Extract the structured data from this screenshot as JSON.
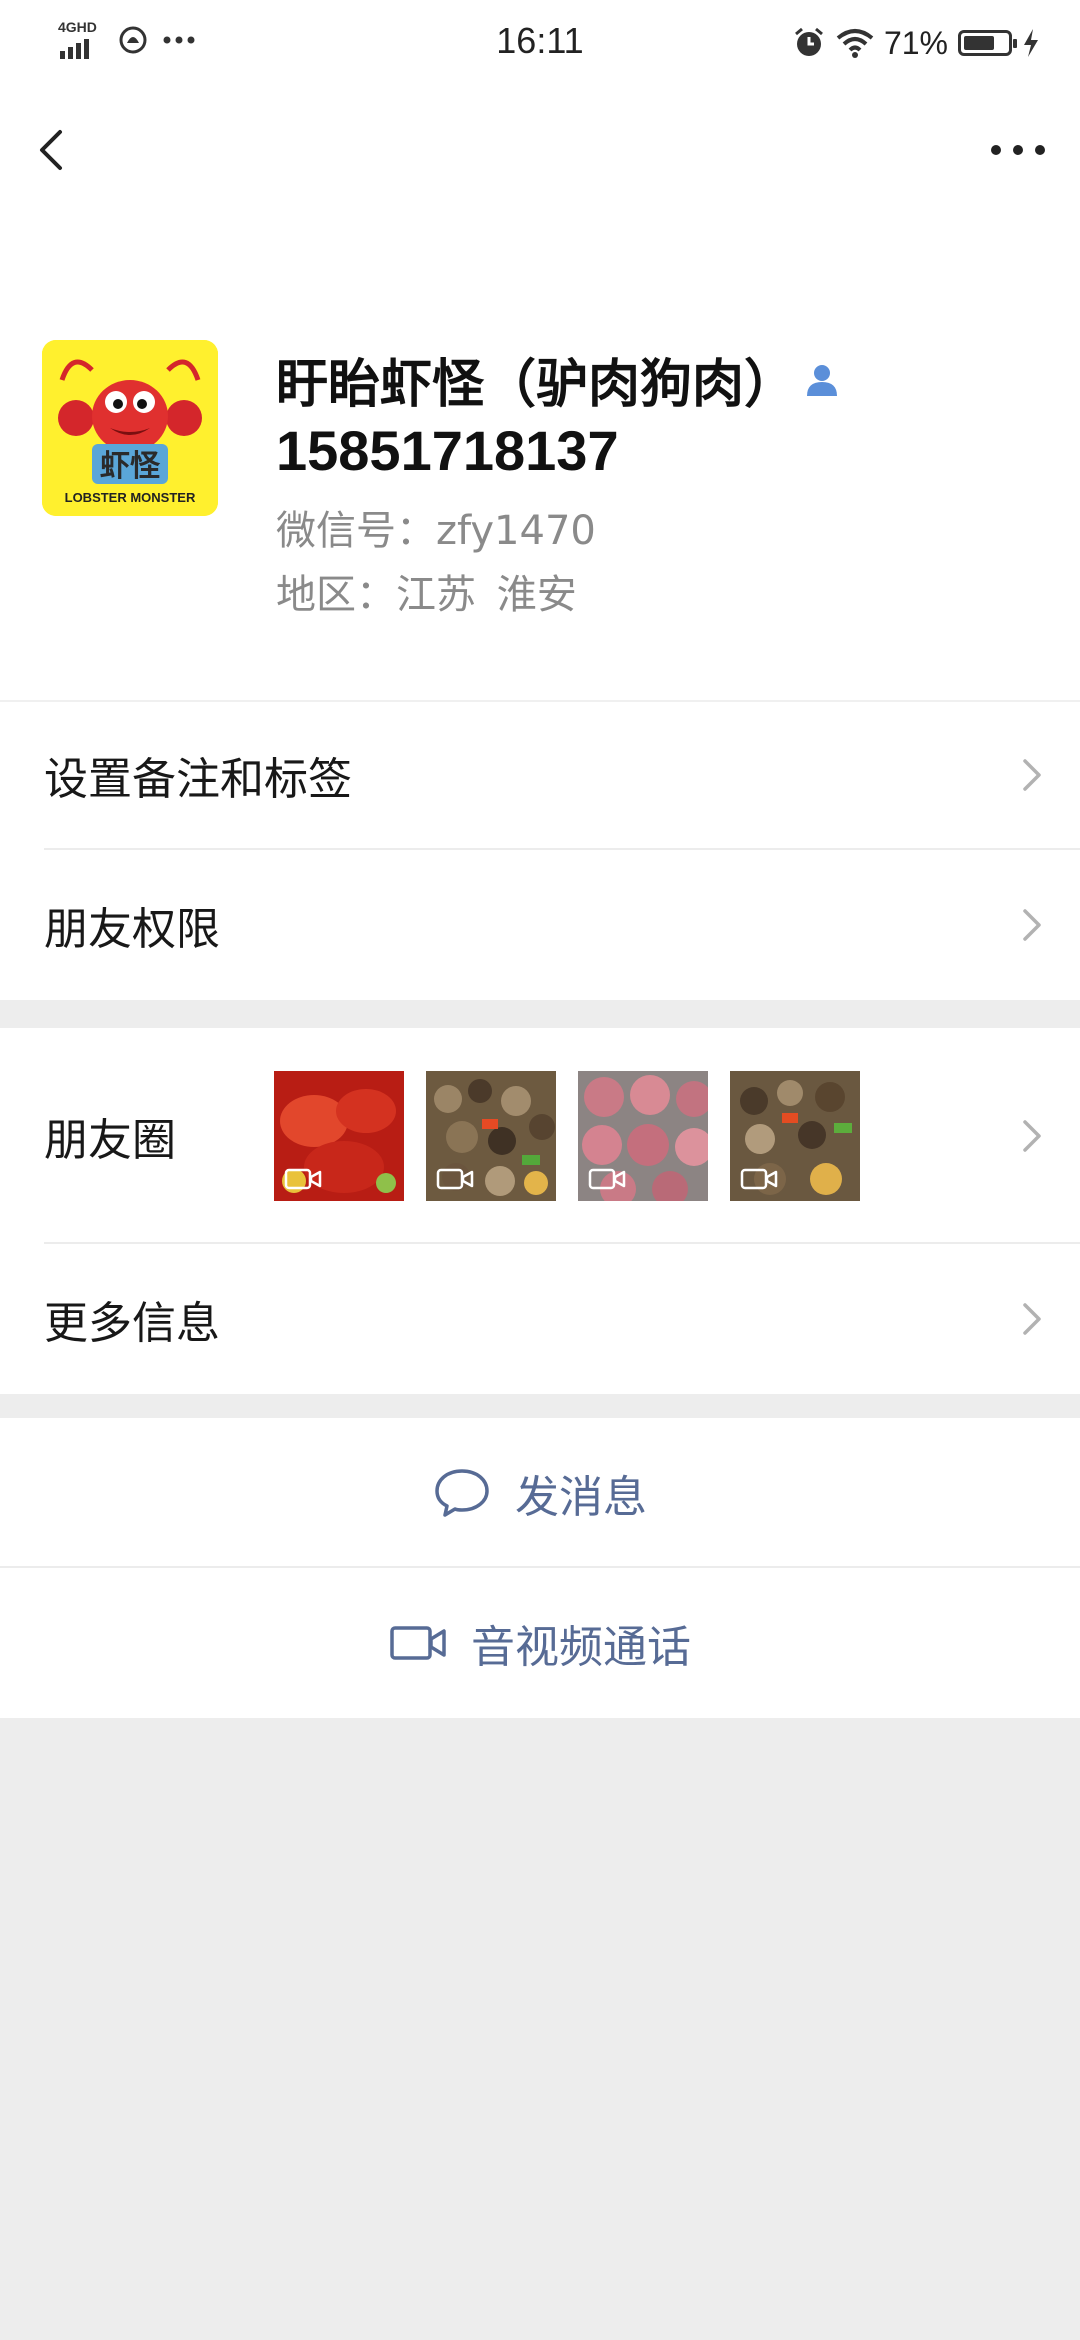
{
  "status_bar": {
    "network": "4GHD",
    "time": "16:11",
    "battery_percent": "71%",
    "battery_level": 0.71,
    "icons": [
      "signal-icon",
      "alert-icon",
      "more-dots-icon",
      "alarm-icon",
      "wifi-icon",
      "battery-icon",
      "charging-icon"
    ]
  },
  "nav": {
    "back_icon": "chevron-left-icon",
    "more_icon": "more-dots-icon"
  },
  "profile": {
    "name": "盱眙虾怪（驴肉狗肉）",
    "phone": "15851718137",
    "wechat_id": "微信号：zfy1470",
    "region": "地区：江苏  淮安",
    "avatar_text": "虾怪",
    "avatar_subtext": "LOBSTER MONSTER"
  },
  "menu": {
    "remark_tags": "设置备注和标签",
    "friend_permissions": "朋友权限",
    "moments": "朋友圈",
    "more_info": "更多信息"
  },
  "actions": {
    "send_message": "发消息",
    "av_call": "音视频通话"
  },
  "colors": {
    "link": "#576b95",
    "background": "#ededed",
    "avatar_bg": "#fff02e",
    "contact_icon": "#5b8fd9"
  }
}
